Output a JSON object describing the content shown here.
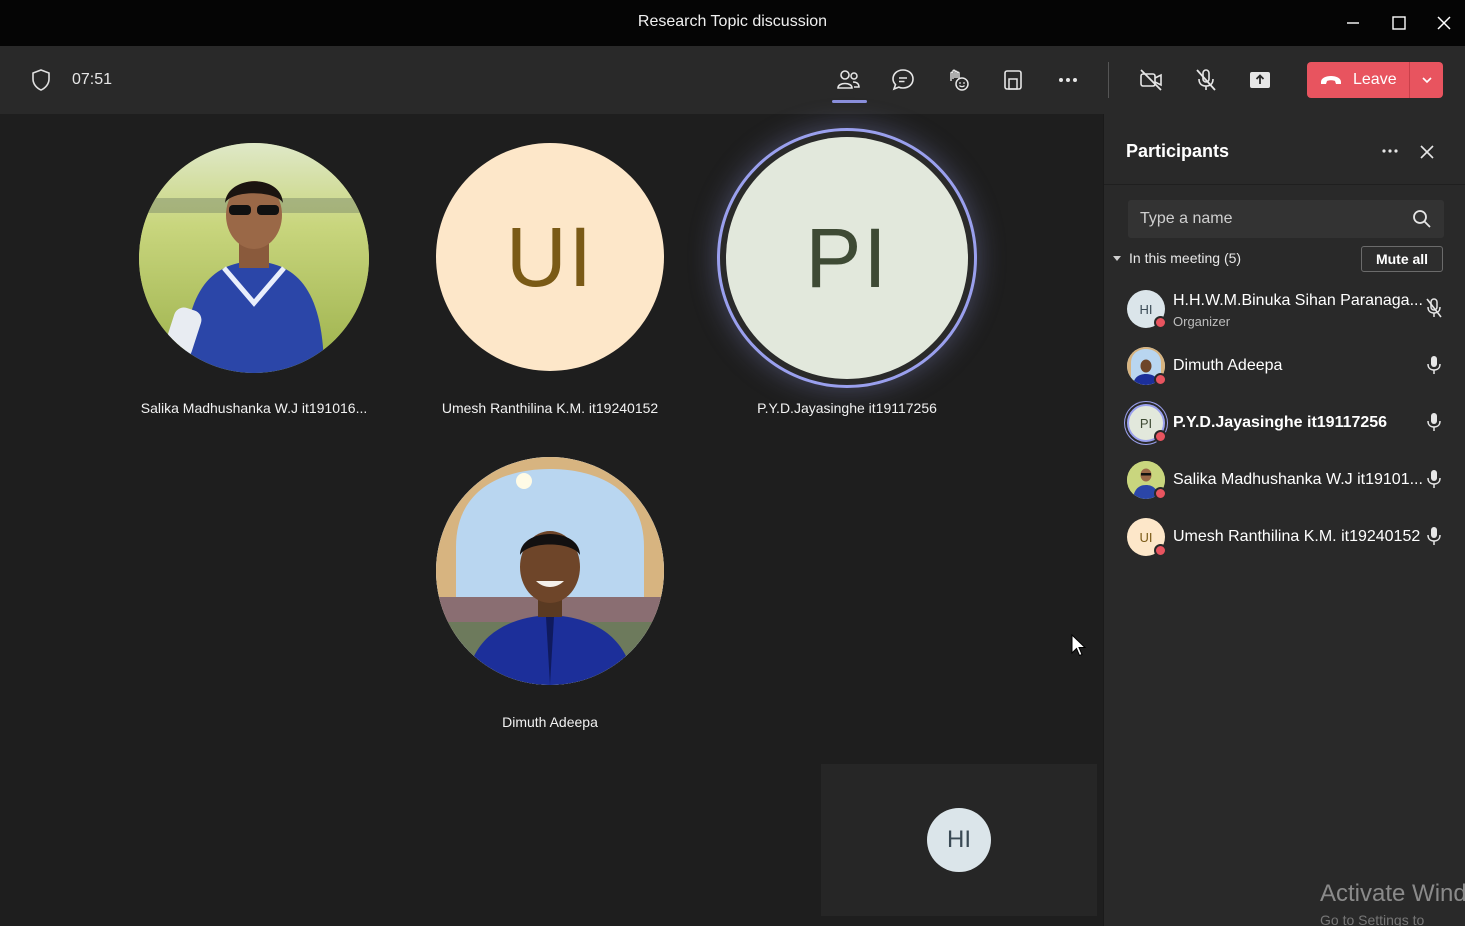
{
  "window": {
    "title": "Research Topic discussion"
  },
  "toolbar": {
    "timer": "07:51",
    "leave_label": "Leave",
    "icons": [
      "shield-icon",
      "people-icon",
      "chat-icon",
      "reactions-icon",
      "rooms-icon",
      "more-icon",
      "camera-off-icon",
      "mic-off-icon",
      "share-icon",
      "phone-icon",
      "chevron-down-icon"
    ],
    "accent": "#8a8fdb",
    "leave_color": "#e8545f"
  },
  "stage": {
    "tiles": [
      {
        "name": "Salika Madhushanka W.J it191016...",
        "type": "photo"
      },
      {
        "name": "Umesh Ranthilina K.M. it19240152",
        "initials": "UI",
        "bg": "#fde7c9",
        "fg": "#7a5a16"
      },
      {
        "name": "P.Y.D.Jayasinghe it19117256",
        "initials": "PI",
        "bg": "#e2e8dc",
        "fg": "#3e4a34",
        "speaking": true
      },
      {
        "name": "Dimuth Adeepa",
        "type": "photo"
      }
    ],
    "self_initials": "HI"
  },
  "panel": {
    "title": "Participants",
    "search_placeholder": "Type a name",
    "meeting_label": "In this meeting (5)",
    "mute_all_label": "Mute all",
    "participants": [
      {
        "name": "H.H.W.M.Binuka Sihan Paranaga...",
        "role": "Organizer",
        "initials": "HI",
        "mic": "muted"
      },
      {
        "name": "Dimuth Adeepa",
        "mic": "on"
      },
      {
        "name": "P.Y.D.Jayasinghe it19117256",
        "initials": "PI",
        "mic": "on"
      },
      {
        "name": "Salika Madhushanka W.J it19101...",
        "mic": "on"
      },
      {
        "name": "Umesh Ranthilina K.M. it19240152",
        "initials": "UI",
        "mic": "on"
      }
    ]
  },
  "watermark": {
    "line1": "Activate Wind",
    "line2": "Go to Settings to"
  }
}
